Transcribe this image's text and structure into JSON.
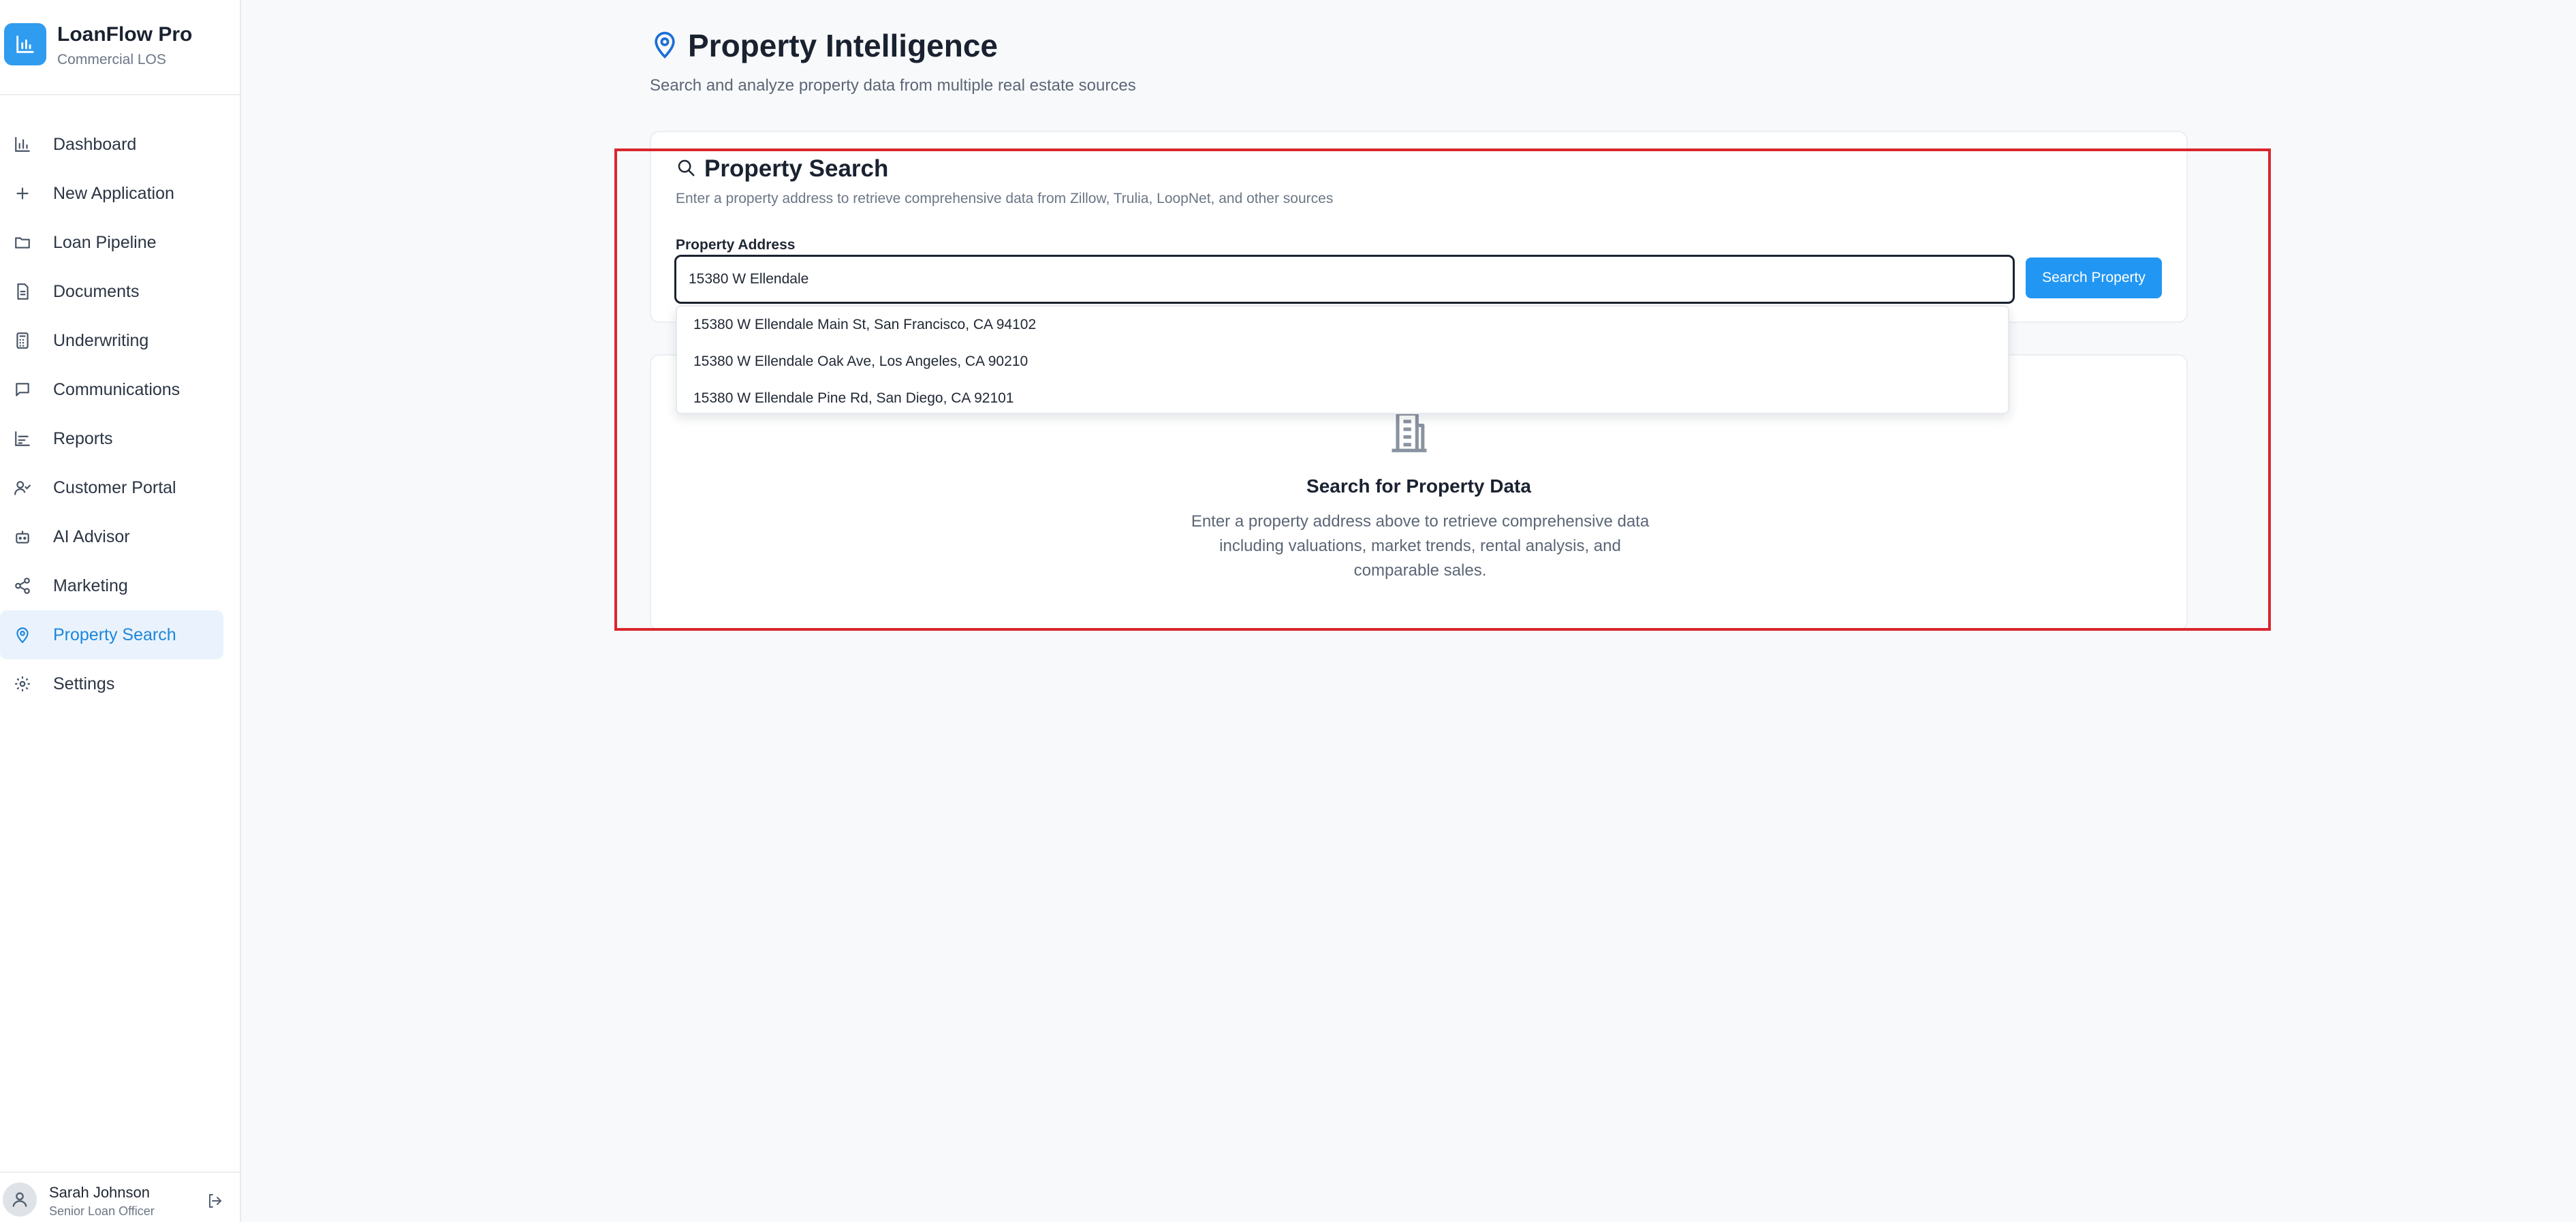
{
  "app": {
    "name": "LoanFlow Pro",
    "subtitle": "Commercial LOS"
  },
  "sidebar": {
    "items": [
      {
        "label": "Dashboard",
        "icon": "bar-chart-icon",
        "active": false
      },
      {
        "label": "New Application",
        "icon": "plus-icon",
        "active": false
      },
      {
        "label": "Loan Pipeline",
        "icon": "folder-icon",
        "active": false
      },
      {
        "label": "Documents",
        "icon": "document-icon",
        "active": false
      },
      {
        "label": "Underwriting",
        "icon": "calculator-icon",
        "active": false
      },
      {
        "label": "Communications",
        "icon": "message-icon",
        "active": false
      },
      {
        "label": "Reports",
        "icon": "chart-icon",
        "active": false
      },
      {
        "label": "Customer Portal",
        "icon": "user-check-icon",
        "active": false
      },
      {
        "label": "AI Advisor",
        "icon": "robot-icon",
        "active": false
      },
      {
        "label": "Marketing",
        "icon": "share-icon",
        "active": false
      },
      {
        "label": "Property Search",
        "icon": "map-pin-icon",
        "active": true
      },
      {
        "label": "Settings",
        "icon": "gear-icon",
        "active": false
      }
    ]
  },
  "user": {
    "name": "Sarah Johnson",
    "role": "Senior Loan Officer"
  },
  "page": {
    "title": "Property Intelligence",
    "subtitle": "Search and analyze property data from multiple real estate sources"
  },
  "search": {
    "title": "Property Search",
    "description": "Enter a property address to retrieve comprehensive data from Zillow, Trulia, LoopNet, and other sources",
    "field_label": "Property Address",
    "input_value": "15380 W Ellendale",
    "button_label": "Search Property",
    "suggestions": [
      "15380 W Ellendale Main St, San Francisco, CA 94102",
      "15380 W Ellendale Oak Ave, Los Angeles, CA 90210",
      "15380 W Ellendale Pine Rd, San Diego, CA 92101"
    ]
  },
  "empty_state": {
    "title": "Search for Property Data",
    "text": "Enter a property address above to retrieve comprehensive data including valuations, market trends, rental analysis, and comparable sales."
  },
  "colors": {
    "accent": "#2196f3",
    "active_nav_bg": "#eaf3fd",
    "highlight": "#d9262c"
  }
}
